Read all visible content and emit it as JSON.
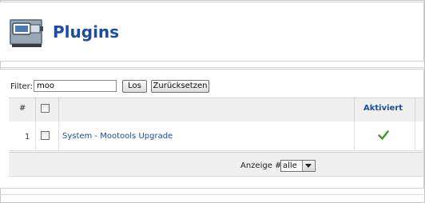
{
  "header": {
    "title": "Plugins",
    "icon": "plugin-icon"
  },
  "filter": {
    "label": "Filter:",
    "value": "moo",
    "go_label": "Los",
    "reset_label": "Zurücksetzen"
  },
  "table": {
    "columns": [
      "#",
      "",
      "",
      "Aktiviert"
    ],
    "rows": [
      {
        "num": "1",
        "name": "System - Mootools Upgrade",
        "enabled": true
      }
    ]
  },
  "footer": {
    "display_label": "Anzeige #",
    "display_value": "alle"
  },
  "colors": {
    "accent": "#1c4ea0",
    "check": "#3a9a22"
  }
}
